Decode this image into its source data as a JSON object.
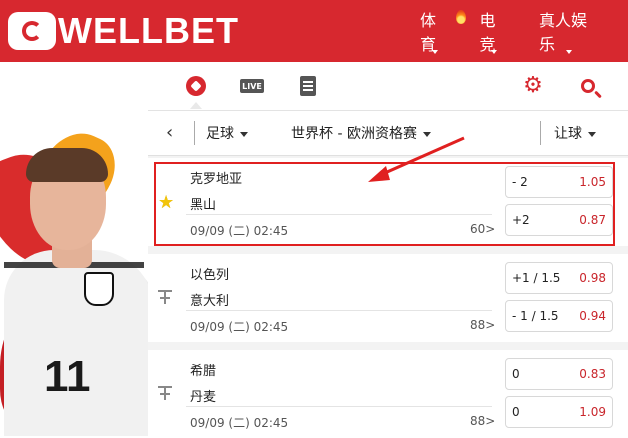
{
  "header": {
    "logo_text": "WELLBET",
    "nav": [
      {
        "label": "体育"
      },
      {
        "label": "电竞"
      },
      {
        "label": "真人娱乐"
      }
    ]
  },
  "toolbar": {
    "live_label": "LIVE"
  },
  "filter": {
    "sport": "足球",
    "league": "世界杯 - 欧洲资格赛",
    "market": "让球"
  },
  "hero": {
    "jersey_number": "11"
  },
  "matches": [
    {
      "home": "克罗地亚",
      "away": "黑山",
      "time": "09/09 (二) 02:45",
      "count": "60>",
      "favorite": true,
      "odds": [
        {
          "handicap": "- 2",
          "value": "1.05"
        },
        {
          "handicap": "+2",
          "value": "0.87"
        }
      ]
    },
    {
      "home": "以色列",
      "away": "意大利",
      "time": "09/09 (二) 02:45",
      "count": "88>",
      "favorite": false,
      "odds": [
        {
          "handicap": "+1 / 1.5",
          "value": "0.98"
        },
        {
          "handicap": "- 1 / 1.5",
          "value": "0.94"
        }
      ]
    },
    {
      "home": "希腊",
      "away": "丹麦",
      "time": "09/09 (二) 02:45",
      "count": "88>",
      "favorite": false,
      "odds": [
        {
          "handicap": "0",
          "value": "0.83"
        },
        {
          "handicap": "0",
          "value": "1.09"
        }
      ]
    }
  ],
  "colors": {
    "brand_red": "#d7282f",
    "odds_red": "#c9252b",
    "highlight": "#e02020",
    "star": "#f2c40c"
  }
}
